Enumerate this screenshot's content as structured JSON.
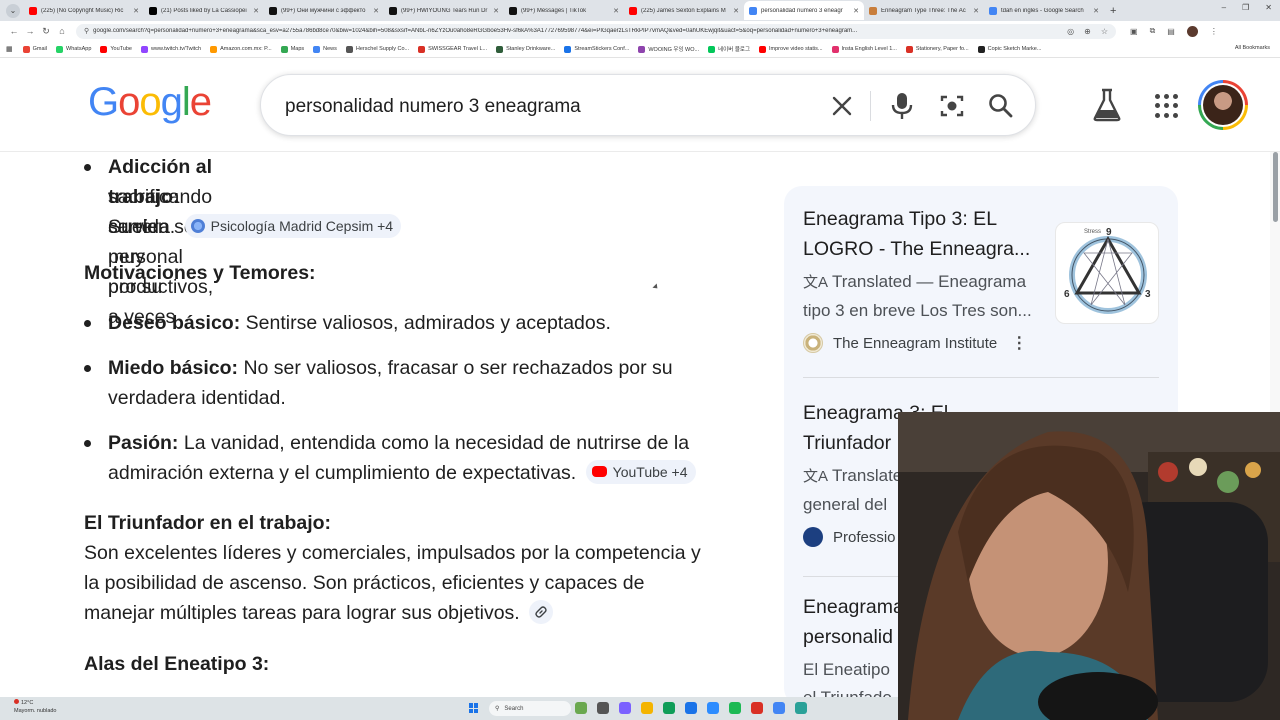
{
  "browser": {
    "tabs": [
      {
        "label": "(225) (No Copyright Music) Ric",
        "color": "#ff0000",
        "active": false
      },
      {
        "label": "(21) Posts liked by La Cassiopei",
        "color": "#000000",
        "active": false
      },
      {
        "label": "(99+) Они мужчини с эффекто",
        "color": "#111111",
        "active": false
      },
      {
        "label": "(99+) HWIYOUNG Tears Run Dr",
        "color": "#111111",
        "active": false
      },
      {
        "label": "(99+) Messages | TikTok",
        "color": "#111111",
        "active": false
      },
      {
        "label": "(225) James Sexton Explains M",
        "color": "#ff0000",
        "active": false
      },
      {
        "label": "personalidad numero 3 eneagr",
        "color": "#4285f4",
        "active": true
      },
      {
        "label": "Enneagram Type Three: The Ac",
        "color": "#c87d3a",
        "active": false
      },
      {
        "label": "tdah en ingles - Google Search",
        "color": "#4285f4",
        "active": false
      }
    ],
    "new_tab": "+",
    "url": "google.com/search?q=personalidad+numero+3+eneagrama&sca_esv=a2755a786bd8ce70&biw=1024&bih=508&sxsrf=ANbL-n6ZYzOu0aho8eRGGboe53Hv-sf6kA%3A1772769598774&ei=PIGqaerzLsTRkPIP7vmAQ&ved=0ahUKEwjqit&uact=5&oq=personalidad+numero+3+eneagram...",
    "bookmarks": [
      {
        "label": "Gmail",
        "color": "#ea4335"
      },
      {
        "label": "WhatsApp",
        "color": "#25d366"
      },
      {
        "label": "YouTube",
        "color": "#ff0000"
      },
      {
        "label": "www.twitch.tv/Twitch",
        "color": "#9146ff"
      },
      {
        "label": "Amazon.com.mx: P...",
        "color": "#ff9900"
      },
      {
        "label": "Maps",
        "color": "#34a853"
      },
      {
        "label": "News",
        "color": "#4285f4"
      },
      {
        "label": "Herschel Supply Co...",
        "color": "#555555"
      },
      {
        "label": "SWISSGEAR Travel L...",
        "color": "#d93025"
      },
      {
        "label": "Stanley Drinkware...",
        "color": "#2f5d3a"
      },
      {
        "label": "StreamStickers Conf...",
        "color": "#1a73e8"
      },
      {
        "label": "WOOING 우잉 WO...",
        "color": "#8e44ad"
      },
      {
        "label": "네이버 블로그",
        "color": "#03c75a"
      },
      {
        "label": "Improve video statis...",
        "color": "#ff0000"
      },
      {
        "label": "Insta English Level 1...",
        "color": "#e1306c"
      },
      {
        "label": "Stationery, Paper fo...",
        "color": "#d93025"
      },
      {
        "label": "Copic Sketch Marke...",
        "color": "#222222"
      }
    ],
    "all_bookmarks": "All Bookmarks"
  },
  "search": {
    "logo": [
      "G",
      "o",
      "o",
      "g",
      "l",
      "e"
    ],
    "logo_colors": [
      "#4285f4",
      "#ea4335",
      "#fbbc05",
      "#4285f4",
      "#34a853",
      "#ea4335"
    ],
    "query": "personalidad numero 3 eneagrama"
  },
  "overview": {
    "b1_bold": "Adicción al trabajo:",
    "b1_text": " Suelen ser muy productivos, a veces",
    "b1_line2": "sacrificando su vida personal por su",
    "b1_line3": "carrera.",
    "b1_chip": "Psicología Madrid Cepsim +4",
    "h_motivations": "Motivaciones y Temores:",
    "b2_bold": "Deseo básico:",
    "b2_text": " Sentirse valiosos, admirados y aceptados.",
    "b3_bold": "Miedo básico:",
    "b3_text": " No ser valiosos, fracasar o ser rechazados por su",
    "b3_line2": "verdadera identidad.",
    "b4_bold": "Pasión:",
    "b4_text": " La vanidad, entendida como la necesidad de nutrirse de la",
    "b4_line2": "admiración externa y el cumplimiento de expectativas.",
    "b4_chip": "YouTube +4",
    "h_work": "El Triunfador en el trabajo:",
    "work_line1": "Son excelentes líderes y comerciales, impulsados por la competencia y",
    "work_line2": "la posibilidad de ascenso. Son prácticos, eficientes y capaces de",
    "work_line3": "manejar múltiples tareas para lograr sus objetivos.",
    "h_wings": "Alas del Eneatipo 3:"
  },
  "sources": [
    {
      "title_line1": "Eneagrama Tipo 3: EL",
      "title_line2": "LOGRO - The Enneagra...",
      "desc_line1": "Translated — Eneagrama",
      "desc_line2": "tipo 3 en breve Los Tres son...",
      "site": "The Enneagram Institute",
      "thumb_label": "Stress"
    },
    {
      "title_line1": "Eneagrama 3: El",
      "title_line2": "Triunfador",
      "desc_line1": "Translate",
      "desc_line2": "general del",
      "site": "Professio"
    },
    {
      "title_line1": "Eneagrama",
      "title_line2": "personalid",
      "desc_line1": "El Eneatipo",
      "desc_line2": "el Triunfado"
    }
  ],
  "taskbar": {
    "temp": "12°C",
    "weather": "Mayorm. nublado",
    "search": "Search",
    "app_colors": [
      "#6aa84f",
      "#555555",
      "#7b61ff",
      "#f4b400",
      "#0f9d58",
      "#1a73e8",
      "#2d8cff",
      "#1db954",
      "#d93025",
      "#4285f4",
      "#2aa198"
    ]
  }
}
